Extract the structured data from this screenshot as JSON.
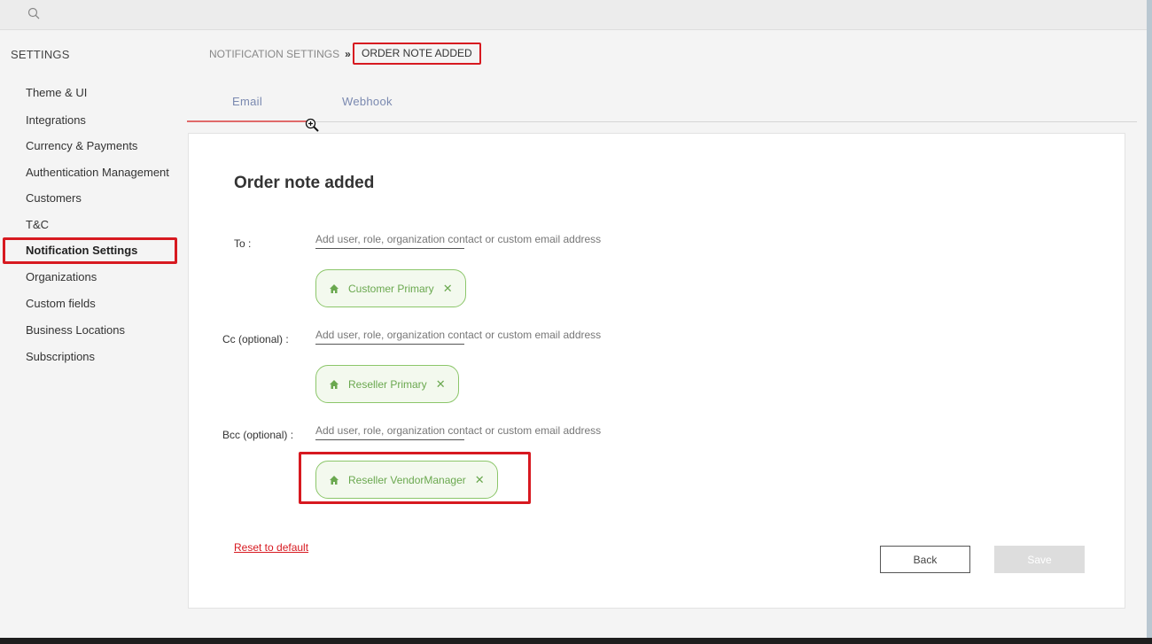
{
  "header": {
    "search_icon": "search-icon"
  },
  "settings_title": "SETTINGS",
  "sidebar": {
    "items": [
      {
        "label": "Theme & UI"
      },
      {
        "label": "Integrations"
      },
      {
        "label": "Currency & Payments"
      },
      {
        "label": "Authentication Management"
      },
      {
        "label": "Customers"
      },
      {
        "label": "T&C"
      },
      {
        "label": "Notification Settings",
        "active": true
      },
      {
        "label": "Organizations"
      },
      {
        "label": "Custom fields"
      },
      {
        "label": "Business Locations"
      },
      {
        "label": "Subscriptions"
      }
    ]
  },
  "breadcrumb": {
    "parent": "NOTIFICATION SETTINGS",
    "separator": "»",
    "current": "ORDER NOTE ADDED"
  },
  "tabs": [
    {
      "label": "Email",
      "active": true
    },
    {
      "label": "Webhook",
      "active": false
    }
  ],
  "form": {
    "title": "Order note added",
    "to": {
      "label": "To :",
      "placeholder": "Add user, role, organization contact or custom email address",
      "chips": [
        "Customer Primary"
      ]
    },
    "cc": {
      "label": "Cc (optional) :",
      "placeholder": "Add user, role, organization contact or custom email address",
      "chips": [
        "Reseller Primary"
      ]
    },
    "bcc": {
      "label": "Bcc (optional) :",
      "placeholder": "Add user, role, organization contact or custom email address",
      "chips": [
        "Reseller VendorManager"
      ]
    },
    "chip_remove": "✕",
    "reset_label": "Reset to default",
    "back_label": "Back",
    "save_label": "Save"
  },
  "colors": {
    "highlight": "#d71920",
    "chip_green": "#6aa84f",
    "tab_blue": "#7a89b0"
  }
}
